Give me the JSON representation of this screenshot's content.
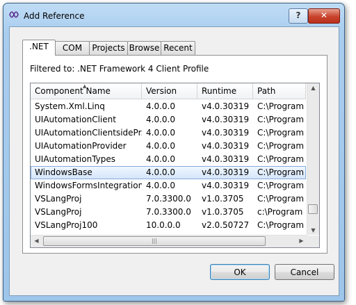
{
  "window": {
    "title": "Add Reference",
    "help_label": "?",
    "close_label": "✕"
  },
  "tabs": [
    {
      "label": ".NET",
      "active": true
    },
    {
      "label": "COM",
      "active": false
    },
    {
      "label": "Projects",
      "active": false
    },
    {
      "label": "Browse",
      "active": false
    },
    {
      "label": "Recent",
      "active": false
    }
  ],
  "filter_text": "Filtered to: .NET Framework 4 Client Profile",
  "columns": [
    "Component Name",
    "Version",
    "Runtime",
    "Path"
  ],
  "rows": [
    {
      "name": "System.Xml.Linq",
      "version": "4.0.0.0",
      "runtime": "v4.0.30319",
      "path": "C:\\Program"
    },
    {
      "name": "UIAutomationClient",
      "version": "4.0.0.0",
      "runtime": "v4.0.30319",
      "path": "C:\\Program"
    },
    {
      "name": "UIAutomationClientsidePr...",
      "version": "4.0.0.0",
      "runtime": "v4.0.30319",
      "path": "C:\\Program"
    },
    {
      "name": "UIAutomationProvider",
      "version": "4.0.0.0",
      "runtime": "v4.0.30319",
      "path": "C:\\Program"
    },
    {
      "name": "UIAutomationTypes",
      "version": "4.0.0.0",
      "runtime": "v4.0.30319",
      "path": "C:\\Program"
    },
    {
      "name": "WindowsBase",
      "version": "4.0.0.0",
      "runtime": "v4.0.30319",
      "path": "C:\\Program",
      "selected": true
    },
    {
      "name": "WindowsFormsIntegration",
      "version": "4.0.0.0",
      "runtime": "v4.0.30319",
      "path": "C:\\Program"
    },
    {
      "name": "VSLangProj",
      "version": "7.0.3300.0",
      "runtime": "v1.0.3705",
      "path": "C:\\Program"
    },
    {
      "name": "VSLangProj",
      "version": "7.0.3300.0",
      "runtime": "v1.0.3705",
      "path": "c:\\Program F"
    },
    {
      "name": "VSLangProj100",
      "version": "10.0.0.0",
      "runtime": "v2.0.50727",
      "path": "C:\\Program"
    }
  ],
  "buttons": {
    "ok": "OK",
    "cancel": "Cancel"
  },
  "colors": {
    "selection": "#d3e5fa",
    "selection_border": "#84acdd",
    "titlebar": "#a9cdef"
  }
}
